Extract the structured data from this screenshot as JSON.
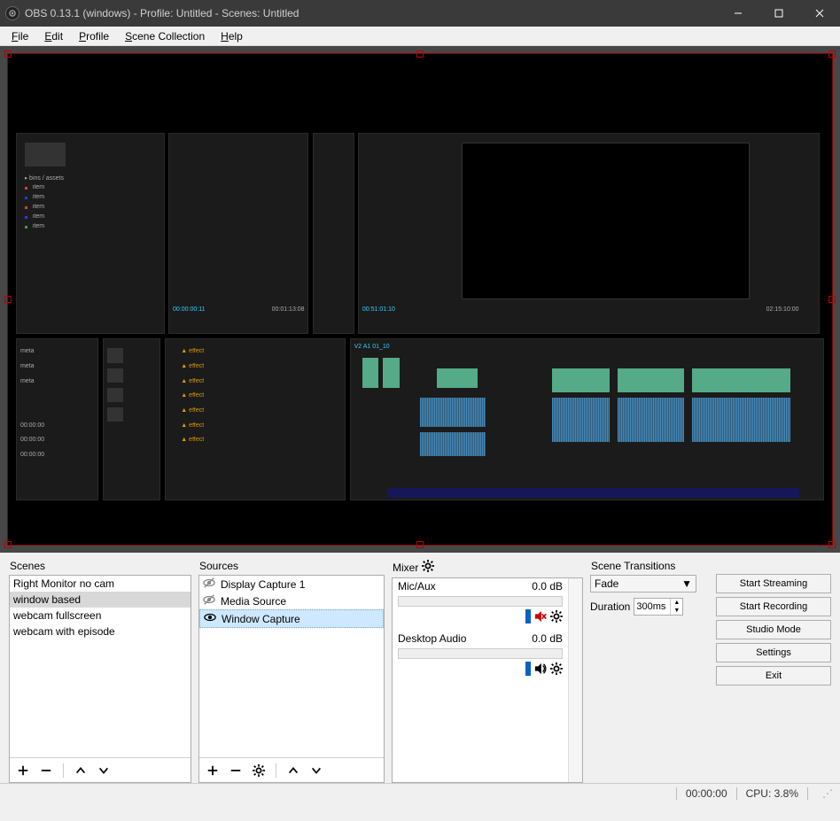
{
  "titlebar": {
    "title": "OBS 0.13.1 (windows) - Profile: Untitled - Scenes: Untitled"
  },
  "menu": {
    "file": "File",
    "edit": "Edit",
    "profile": "Profile",
    "scene_collection": "Scene Collection",
    "help": "Help"
  },
  "panels": {
    "scenes": {
      "label": "Scenes",
      "items": [
        {
          "label": "Right Monitor no cam"
        },
        {
          "label": "window based"
        },
        {
          "label": "webcam fullscreen"
        },
        {
          "label": "webcam with episode"
        }
      ],
      "selected_index": 1
    },
    "sources": {
      "label": "Sources",
      "items": [
        {
          "label": "Display Capture 1",
          "visible": false
        },
        {
          "label": "Media Source",
          "visible": false
        },
        {
          "label": "Window Capture",
          "visible": true
        }
      ],
      "selected_index": 2
    },
    "mixer": {
      "label": "Mixer",
      "channels": [
        {
          "name": "Mic/Aux",
          "db": "0.0 dB",
          "muted": true
        },
        {
          "name": "Desktop Audio",
          "db": "0.0 dB",
          "muted": false
        }
      ]
    },
    "transitions": {
      "label": "Scene Transitions",
      "selected": "Fade",
      "duration_label": "Duration",
      "duration_value": "300ms"
    },
    "controls": {
      "start_streaming": "Start Streaming",
      "start_recording": "Start Recording",
      "studio_mode": "Studio Mode",
      "settings": "Settings",
      "exit": "Exit"
    }
  },
  "statusbar": {
    "time": "00:00:00",
    "cpu": "CPU: 3.8%"
  }
}
